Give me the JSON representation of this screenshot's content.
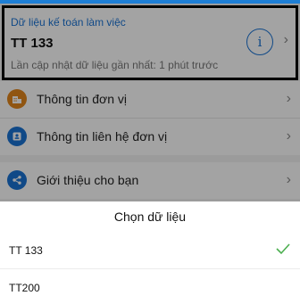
{
  "data_card": {
    "heading": "Dữ liệu kế toán làm việc",
    "value": "TT 133",
    "last_updated": "Lần cập nhật dữ liệu gần nhất: 1 phút trước",
    "info_glyph": "i"
  },
  "menu": [
    {
      "label": "Thông tin đơn vị",
      "icon": "building-icon",
      "color": "#e2851c"
    },
    {
      "label": "Thông tin liên hệ đơn vị",
      "icon": "contact-card-icon",
      "color": "#1a73d4"
    },
    {
      "label": "Giới thiệu cho bạn",
      "icon": "share-icon",
      "color": "#1a73d4"
    }
  ],
  "sheet": {
    "title": "Chọn dữ liệu",
    "options": [
      {
        "label": "TT 133",
        "selected": true
      },
      {
        "label": "TT200",
        "selected": false
      }
    ]
  },
  "colors": {
    "accent": "#1a73d4",
    "check": "#4caf50",
    "orange": "#e2851c"
  }
}
